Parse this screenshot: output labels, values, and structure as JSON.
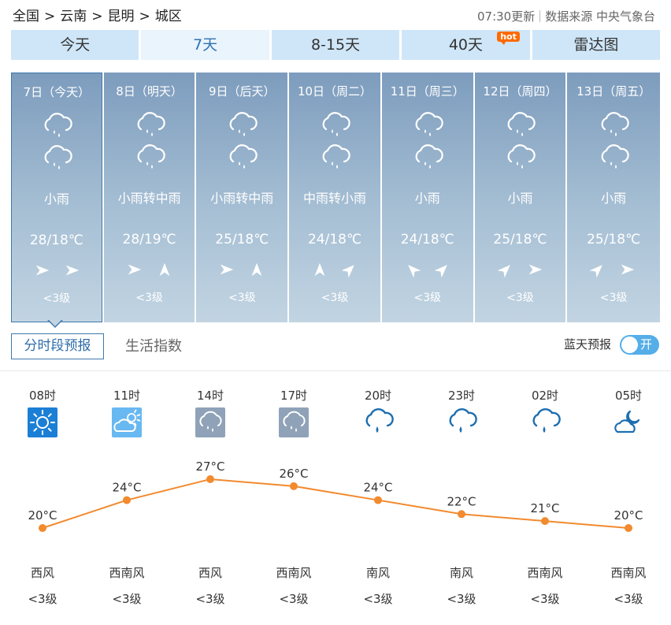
{
  "breadcrumb": [
    "全国",
    "云南",
    "昆明",
    "城区"
  ],
  "breadcrumb_sep": ">",
  "update": {
    "time": "07:30更新",
    "source": "数据来源 中央气象台"
  },
  "tabs": [
    {
      "label": "今天",
      "active": false
    },
    {
      "label": "7天",
      "active": true
    },
    {
      "label": "8-15天",
      "active": false
    },
    {
      "label": "40天",
      "active": false,
      "badge": "hot"
    },
    {
      "label": "雷达图",
      "active": false
    }
  ],
  "days": [
    {
      "date": "7日（今天）",
      "desc": "小雨",
      "temp": "28/18℃",
      "wind": [
        "arrow-right",
        "arrow-right"
      ],
      "level": "<3级",
      "active": true
    },
    {
      "date": "8日（明天）",
      "desc": "小雨转中雨",
      "temp": "28/19℃",
      "wind": [
        "arrow-right",
        "arrow-up"
      ],
      "level": "<3级"
    },
    {
      "date": "9日（后天）",
      "desc": "小雨转中雨",
      "temp": "25/18℃",
      "wind": [
        "arrow-right",
        "arrow-up"
      ],
      "level": "<3级"
    },
    {
      "date": "10日（周二）",
      "desc": "中雨转小雨",
      "temp": "24/18℃",
      "wind": [
        "arrow-up",
        "arrow-up-right"
      ],
      "level": "<3级"
    },
    {
      "date": "11日（周三）",
      "desc": "小雨",
      "temp": "24/18℃",
      "wind": [
        "arrow-up-left",
        "arrow-up-right"
      ],
      "level": "<3级"
    },
    {
      "date": "12日（周四）",
      "desc": "小雨",
      "temp": "25/18℃",
      "wind": [
        "arrow-up-right",
        "arrow-right"
      ],
      "level": "<3级"
    },
    {
      "date": "13日（周五）",
      "desc": "小雨",
      "temp": "25/18℃",
      "wind": [
        "arrow-up-right",
        "arrow-right"
      ],
      "level": "<3级"
    }
  ],
  "subtabs": {
    "active": "分时段预报",
    "other": "生活指数"
  },
  "bluesky": {
    "label": "蓝天预报",
    "toggle": "开"
  },
  "hourly": [
    {
      "time": "08时",
      "icon": "sun-icon",
      "temp": 20,
      "wind_dir": "西风",
      "wind_level": "<3级"
    },
    {
      "time": "11时",
      "icon": "cloudy-sun-icon",
      "temp": 24,
      "wind_dir": "西南风",
      "wind_level": "<3级"
    },
    {
      "time": "14时",
      "icon": "rain-box-icon",
      "temp": 27,
      "wind_dir": "西风",
      "wind_level": "<3级"
    },
    {
      "time": "17时",
      "icon": "rain-box-icon",
      "temp": 26,
      "wind_dir": "西南风",
      "wind_level": "<3级"
    },
    {
      "time": "20时",
      "icon": "rain-night-icon",
      "temp": 24,
      "wind_dir": "南风",
      "wind_level": "<3级"
    },
    {
      "time": "23时",
      "icon": "rain-night-icon",
      "temp": 22,
      "wind_dir": "南风",
      "wind_level": "<3级"
    },
    {
      "time": "02时",
      "icon": "rain-night-icon",
      "temp": 21,
      "wind_dir": "西南风",
      "wind_level": "<3级"
    },
    {
      "time": "05时",
      "icon": "cloudy-night-icon",
      "temp": 20,
      "wind_dir": "西南风",
      "wind_level": "<3级"
    }
  ],
  "temp_unit": "°C",
  "chart_data": {
    "type": "line",
    "categories": [
      "08时",
      "11时",
      "14时",
      "17时",
      "20时",
      "23时",
      "02时",
      "05时"
    ],
    "values": [
      20,
      24,
      27,
      26,
      24,
      22,
      21,
      20
    ],
    "title": "",
    "xlabel": "",
    "ylabel": ""
  },
  "colors": {
    "accent": "#3d79ad",
    "tab_bg": "#cfe6f8",
    "line": "#f28a2e",
    "toggle": "#55aee8",
    "hot": "#ff6a00"
  }
}
